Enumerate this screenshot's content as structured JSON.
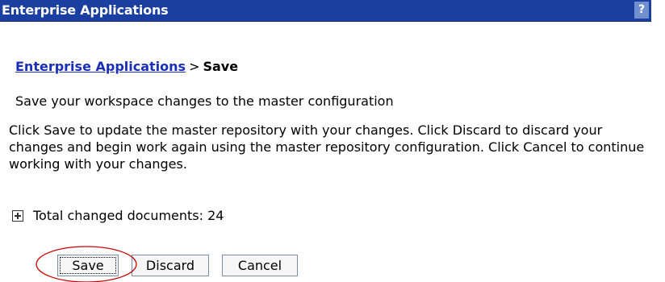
{
  "title_bar": {
    "title": "Enterprise Applications",
    "help_label": "?"
  },
  "breadcrumb": {
    "link": "Enterprise Applications",
    "separator": ">",
    "current": "Save"
  },
  "subtitle": "Save your workspace changes to the master configuration",
  "description": "Click Save to update the master repository with your changes. Click Discard to discard your changes and begin work again using the master repository configuration. Click Cancel to continue working with your changes.",
  "changed_documents": {
    "label": "Total changed documents: 24"
  },
  "buttons": {
    "save": "Save",
    "discard": "Discard",
    "cancel": "Cancel"
  },
  "colors": {
    "title_bar": "#1a3fa0",
    "link": "#1a2fb8",
    "annotation": "#cc0000"
  },
  "icons": {
    "help": "help-icon",
    "expand": "plus-box-icon"
  }
}
